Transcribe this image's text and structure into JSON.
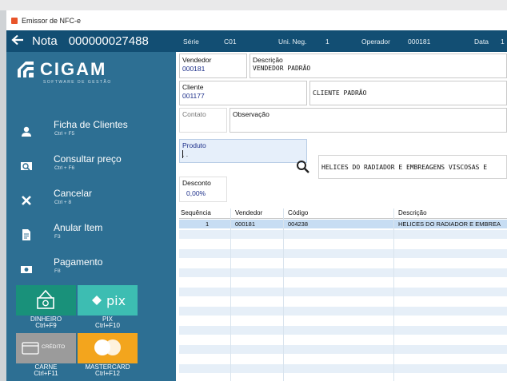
{
  "window": {
    "title": "Emissor de NFC-e"
  },
  "header": {
    "nota_label": "Nota",
    "nota_number": "000000027488",
    "serie_label": "Série",
    "serie_value": "C01",
    "unineg_label": "Uni. Neg.",
    "unineg_value": "1",
    "operador_label": "Operador",
    "operador_value": "000181",
    "data_label": "Data",
    "data_value": "1"
  },
  "logo": {
    "word": "CIGAM",
    "subtitle": "SOFTWARE DE GESTÃO"
  },
  "menu": [
    {
      "label": "Ficha de Clientes",
      "shortcut": "Ctrl + F5",
      "icon": "user-icon"
    },
    {
      "label": "Consultar preço",
      "shortcut": "Ctrl + F6",
      "icon": "price-lookup-icon"
    },
    {
      "label": "Cancelar",
      "shortcut": "Ctrl + 8",
      "icon": "close-icon"
    },
    {
      "label": "Anular Item",
      "shortcut": "F3",
      "icon": "document-icon"
    },
    {
      "label": "Pagamento",
      "shortcut": "F8",
      "icon": "payment-icon"
    }
  ],
  "payments": [
    {
      "name": "DINHEIRO",
      "shortcut": "Ctrl+F9",
      "color": "#19917a",
      "icon": "cash-icon"
    },
    {
      "name": "PIX",
      "shortcut": "Ctrl+F10",
      "color": "#3dbdb2",
      "icon": "pix-icon",
      "tile_text": "pix"
    },
    {
      "name": "CARNE",
      "shortcut": "Ctrl+F11",
      "color": "#9b9b9b",
      "icon": "credit-card-icon",
      "tile_text": "CRÉDITO"
    },
    {
      "name": "MASTERCARD",
      "shortcut": "Ctrl+F12",
      "color": "#f3a51d",
      "icon": "mastercard-icon"
    }
  ],
  "form": {
    "vendedor": {
      "label": "Vendedor",
      "value": "000181"
    },
    "descricao": {
      "label": "Descrição",
      "value": "VENDEDOR PADRÃO"
    },
    "cliente": {
      "label": "Cliente",
      "value": "001177",
      "name": "CLIENTE PADRÃO"
    },
    "contato": {
      "label": "Contato",
      "value": ""
    },
    "observacao": {
      "label": "Observação",
      "value": ""
    },
    "produto": {
      "label": "Produto",
      "value": ". .",
      "description": "HELICES DO RADIADOR E EMBREAGENS VISCOSAS E"
    },
    "desconto": {
      "label": "Desconto",
      "value": "0,00%"
    }
  },
  "grid": {
    "columns": [
      "Sequência",
      "Vendedor",
      "Código",
      "Descrição"
    ],
    "rows": [
      [
        "1",
        "000181",
        "004238",
        "HELICES DO RADIADOR E EMBREA"
      ]
    ]
  },
  "colors": {
    "header_bg": "#124e73",
    "sidebar_bg": "#2d6f93",
    "selected_row": "#c7ddf3",
    "alt_row": "#e6eff8"
  }
}
